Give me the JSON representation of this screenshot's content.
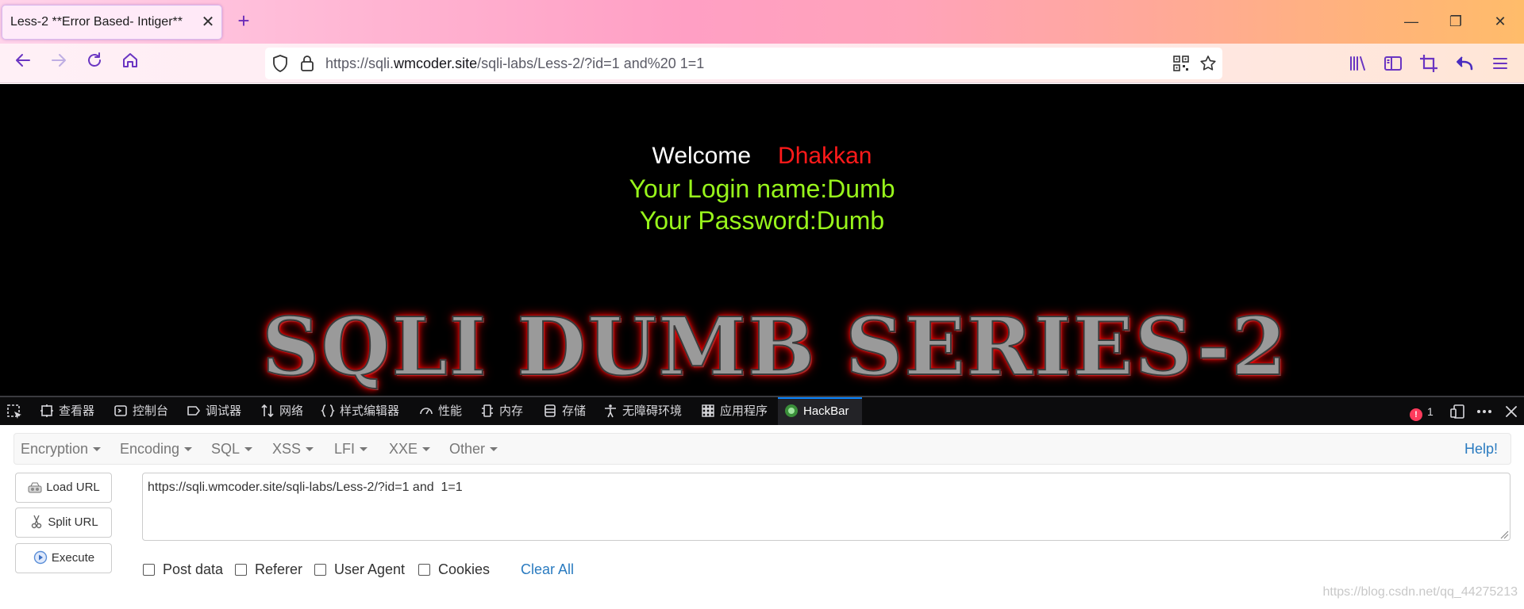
{
  "browser": {
    "tab_title": "Less-2 **Error Based- Intiger**",
    "tab_close_glyph": "✕",
    "new_tab_glyph": "+",
    "window_controls": {
      "minimize": "—",
      "restore": "❐",
      "close": "✕"
    },
    "url": {
      "prefix": "https://sqli.",
      "domain": "wmcoder.site",
      "path": "/sqli-labs/Less-2/?id=1 and%20 1=1"
    },
    "icons": {
      "back": "back-arrow-icon",
      "forward": "forward-arrow-icon",
      "reload": "reload-icon",
      "home": "home-icon",
      "shield": "tracking-shield-icon",
      "lock": "lock-icon",
      "qr": "qr-code-icon",
      "bookmark": "star-bookmark-icon",
      "library": "library-icon",
      "sidebar": "sidebar-icon",
      "screenshot": "crop-screenshot-icon",
      "undo": "undo-arrow-icon",
      "menu": "hamburger-menu-icon"
    }
  },
  "page": {
    "welcome_word": "Welcome",
    "welcome_name": "Dhakkan",
    "login_line": "Your Login name:Dumb",
    "password_line": "Your Password:Dumb",
    "banner_text": "SQLI DUMB SERIES-2",
    "colors": {
      "background": "#000000",
      "name": "#ff1a1a",
      "credentials": "#98f51b",
      "banner_glow": "#ff0000"
    }
  },
  "devtools": {
    "tabs": [
      {
        "label": "查看器",
        "icon": "inspector-icon"
      },
      {
        "label": "控制台",
        "icon": "console-icon"
      },
      {
        "label": "调试器",
        "icon": "debugger-icon"
      },
      {
        "label": "网络",
        "icon": "network-icon"
      },
      {
        "label": "样式编辑器",
        "icon": "style-editor-icon"
      },
      {
        "label": "性能",
        "icon": "performance-icon"
      },
      {
        "label": "内存",
        "icon": "memory-icon"
      },
      {
        "label": "存储",
        "icon": "storage-icon"
      },
      {
        "label": "无障碍环境",
        "icon": "accessibility-icon"
      },
      {
        "label": "应用程序",
        "icon": "application-icon"
      },
      {
        "label": "HackBar",
        "icon": "hackbar-icon"
      }
    ],
    "error_count": "1"
  },
  "hackbar": {
    "menu": [
      "Encryption",
      "Encoding",
      "SQL",
      "XSS",
      "LFI",
      "XXE",
      "Other"
    ],
    "help": "Help!",
    "buttons": {
      "load": "Load URL",
      "split": "Split URL",
      "execute": "Execute"
    },
    "url_value": "https://sqli.wmcoder.site/sqli-labs/Less-2/?id=1 and  1=1",
    "options": [
      "Post data",
      "Referer",
      "User Agent",
      "Cookies"
    ],
    "clear_all": "Clear All",
    "watermark": "https://blog.csdn.net/qq_44275213"
  }
}
